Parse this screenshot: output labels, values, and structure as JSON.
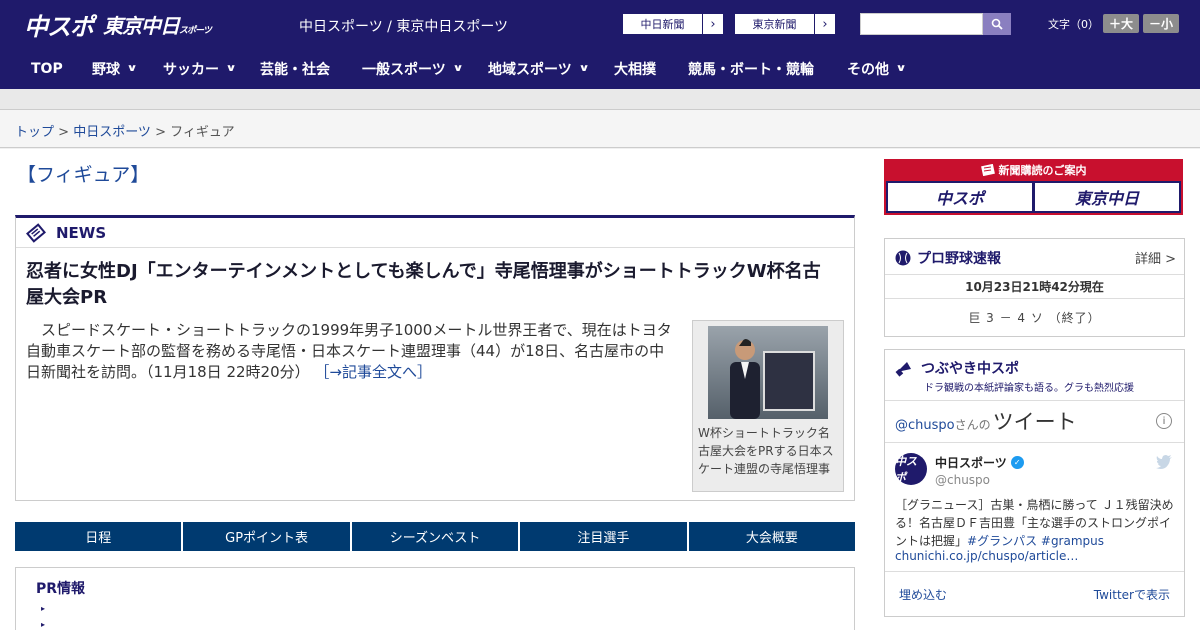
{
  "header": {
    "logo_main": "中スポ",
    "logo_sub": "東京中日",
    "logo_sub_small": "スポーツ",
    "site_title": "中日スポーツ / 東京中日スポーツ",
    "np_buttons": [
      "中日新聞",
      "東京新聞"
    ],
    "font_label": "文字（0）",
    "font_bigger": "＋大",
    "font_smaller": "－小"
  },
  "nav": {
    "items": [
      {
        "label": "TOP",
        "has_menu": false
      },
      {
        "label": "野球",
        "has_menu": true
      },
      {
        "label": "サッカー",
        "has_menu": true
      },
      {
        "label": "芸能・社会",
        "has_menu": false
      },
      {
        "label": "一般スポーツ",
        "has_menu": true
      },
      {
        "label": "地域スポーツ",
        "has_menu": true
      },
      {
        "label": "大相撲",
        "has_menu": false
      },
      {
        "label": "競馬・ボート・競輪",
        "has_menu": false
      },
      {
        "label": "その他",
        "has_menu": true
      }
    ]
  },
  "breadcrumb": {
    "home": "トップ",
    "sep1": " > ",
    "section": "中日スポーツ",
    "sep2": " > ",
    "current": "フィギュア"
  },
  "page": {
    "title": "【フィギュア】"
  },
  "news": {
    "label": "NEWS",
    "headline": "忍者に女性DJ「エンターテインメントとしても楽しんで」寺尾悟理事がショートトラックW杯名古屋大会PR",
    "body": "スピードスケート・ショートトラックの1999年男子1000メートル世界王者で、現在はトヨタ自動車スケート部の監督を務める寺尾悟・日本スケート連盟理事（44）が18日、名古屋市の中日新聞社を訪問。（11月18日 22時20分）",
    "more": "［→記事全文へ］",
    "photo_caption": "W杯ショートトラック名古屋大会をPRする日本スケート連盟の寺尾悟理事"
  },
  "tabs": [
    "日程",
    "GPポイント表",
    "シーズンベスト",
    "注目選手",
    "大会概要"
  ],
  "pr": {
    "title": "PR情報",
    "bullet": "▸"
  },
  "subscription": {
    "label": "新聞購読のご案内",
    "logos": [
      "中スポ",
      "東京中日"
    ]
  },
  "baseball": {
    "title": "プロ野球速報",
    "more": "詳細 >",
    "time": "10月23日21時42分現在",
    "score": "巨 3 － 4 ソ （終了）"
  },
  "tweets": {
    "title": "つぶやき中スポ",
    "subtitle": "ドラ観戦の本紙評論家も語る。グラも熱烈応援",
    "handle_prefix": "@chuspo",
    "handle_suffix": "さんの",
    "heading": "ツイート",
    "account_name": "中日スポーツ",
    "account_handle": "@chuspo",
    "text": "［グラニュース］古巣・鳥栖に勝って Ｊ１残留決める！名古屋ＤＦ吉田豊「主な選手のストロングポイントは把握」",
    "hashtags": "#グランパス #grampus",
    "link": "chunichi.co.jp/chuspo/article…",
    "embed": "埋め込む",
    "view": "Twitterで表示"
  },
  "colors": {
    "brand_navy": "#1f1a6b",
    "tab_blue": "#003a70",
    "link_blue": "#1f4a99",
    "subscribe_red": "#c8102e"
  }
}
